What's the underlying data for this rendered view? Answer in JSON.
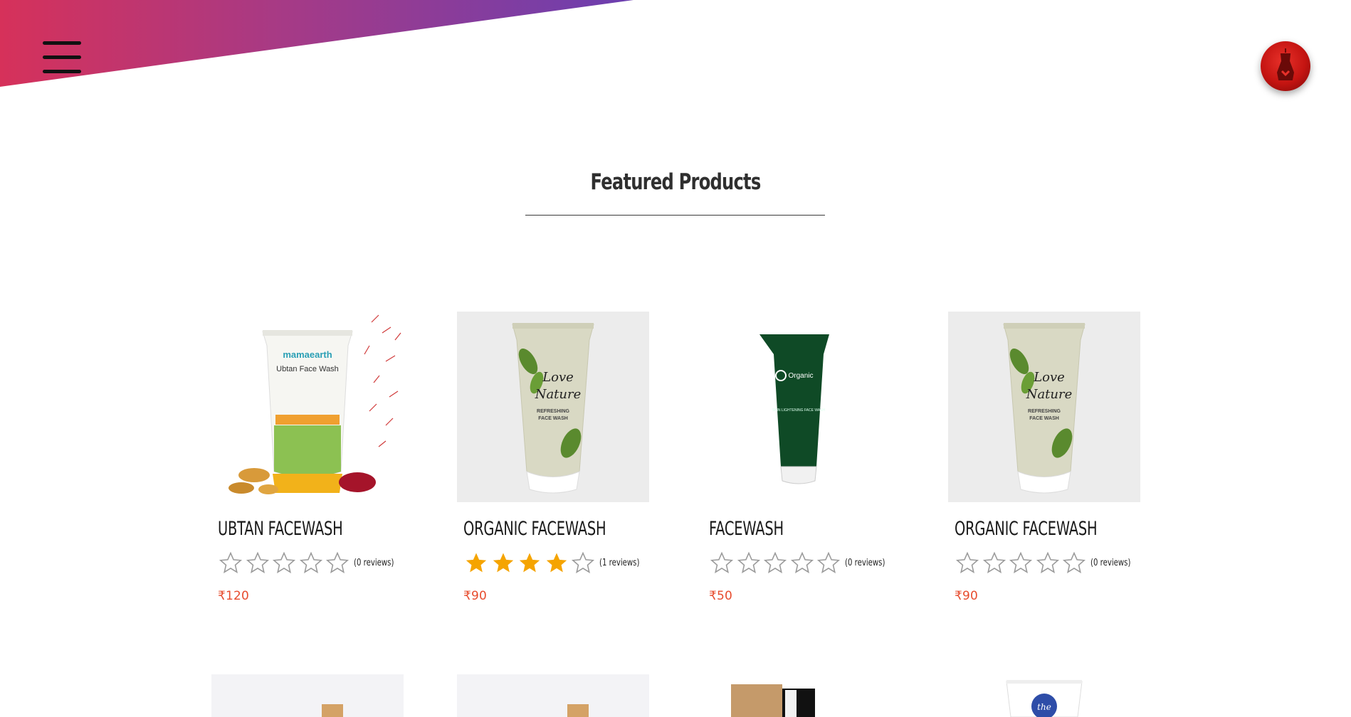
{
  "header": {
    "menu_icon": "hamburger-menu-icon",
    "profile_icon": "red-profile-avatar"
  },
  "section": {
    "title": "Featured Products"
  },
  "products": [
    {
      "name": "UBTAN FACEWASH",
      "rating": 0,
      "reviews": "(0 reviews)",
      "price": "₹120",
      "image": "mamaearth-ubtan-tube"
    },
    {
      "name": "ORGANIC FACEWASH",
      "rating": 4,
      "reviews": "(1 reviews)",
      "price": "₹90",
      "image": "oriflame-love-nature-tube"
    },
    {
      "name": "FACEWASH",
      "rating": 0,
      "reviews": "(0 reviews)",
      "price": "₹50",
      "image": "organic-harvest-green-tube"
    },
    {
      "name": "ORGANIC FACEWASH",
      "rating": 0,
      "reviews": "(0 reviews)",
      "price": "₹90",
      "image": "oriflame-love-nature-tube"
    }
  ],
  "colors": {
    "accent_pink": "#d6315a",
    "accent_purple": "#6b3fb0",
    "price": "#e74c2e",
    "star_filled": "#f5a400",
    "star_empty": "#9a9a9a"
  }
}
